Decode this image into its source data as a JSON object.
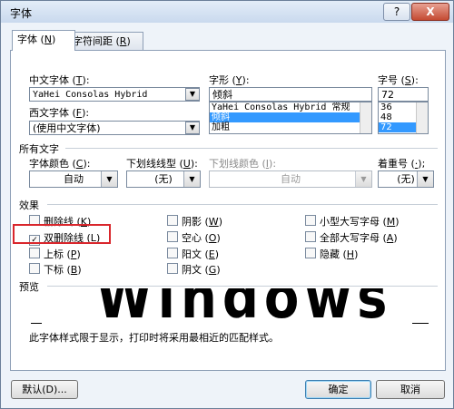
{
  "window": {
    "title": "字体",
    "help_label": "?",
    "close_label": "X"
  },
  "tabs": [
    {
      "label_pre": "字体 (",
      "key": "N",
      "label_post": ")"
    },
    {
      "label_pre": "字符间距 (",
      "key": "R",
      "label_post": ")"
    }
  ],
  "font": {
    "chinese_label_pre": "中文字体 (",
    "chinese_key": "T",
    "chinese_label_post": "):",
    "chinese_value": "YaHei Consolas Hybrid",
    "western_label_pre": "西文字体 (",
    "western_key": "F",
    "western_label_post": "):",
    "western_value": "(使用中文字体)",
    "style_label_pre": "字形 (",
    "style_key": "Y",
    "style_label_post": "):",
    "style_value": "倾斜",
    "style_options": [
      "YaHei Consolas Hybrid 常规",
      "倾斜",
      "加粗"
    ],
    "size_label_pre": "字号 (",
    "size_key": "S",
    "size_label_post": "):",
    "size_value": "72",
    "size_options": [
      "36",
      "48",
      "72"
    ]
  },
  "all_text": {
    "section_label": "所有文字",
    "color_label_pre": "字体颜色 (",
    "color_key": "C",
    "color_label_post": "):",
    "color_value": "自动",
    "underline_label_pre": "下划线线型 (",
    "underline_key": "U",
    "underline_label_post": "):",
    "underline_value": "(无)",
    "underline_color_label_pre": "下划线颜色 (",
    "underline_color_key": "I",
    "underline_color_label_post": "):",
    "underline_color_value": "自动",
    "emphasis_label_pre": "着重号 (",
    "emphasis_key": "·",
    "emphasis_label_post": ");",
    "emphasis_value": "(无)"
  },
  "effects": {
    "section_label": "效果",
    "items": [
      {
        "label": "删除线 (",
        "key": "K",
        "post": ")",
        "check": ""
      },
      {
        "label": "双删除线 (",
        "key": "L",
        "post": ")",
        "check": "✓"
      },
      {
        "label": "上标 (",
        "key": "P",
        "post": ")",
        "check": ""
      },
      {
        "label": "下标 (",
        "key": "B",
        "post": ")",
        "check": ""
      },
      {
        "label": "阴影 (",
        "key": "W",
        "post": ")",
        "check": ""
      },
      {
        "label": "空心 (",
        "key": "O",
        "post": ")",
        "check": ""
      },
      {
        "label": "阳文 (",
        "key": "E",
        "post": ")",
        "check": ""
      },
      {
        "label": "阴文 (",
        "key": "G",
        "post": ")",
        "check": ""
      },
      {
        "label": "小型大写字母 (",
        "key": "M",
        "post": ")",
        "check": ""
      },
      {
        "label": "全部大写字母 (",
        "key": "A",
        "post": ")",
        "check": ""
      },
      {
        "label": "隐藏 (",
        "key": "H",
        "post": ")",
        "check": ""
      }
    ]
  },
  "preview": {
    "section_label": "预览",
    "sample_text": "Windows",
    "note": "此字体样式限于显示，打印时将采用最相近的匹配样式。"
  },
  "buttons": {
    "default_label": "默认(D)...",
    "ok_label": "确定",
    "cancel_label": "取消"
  },
  "colors": {
    "highlight": "#d9262c",
    "selection": "#3399ff"
  }
}
